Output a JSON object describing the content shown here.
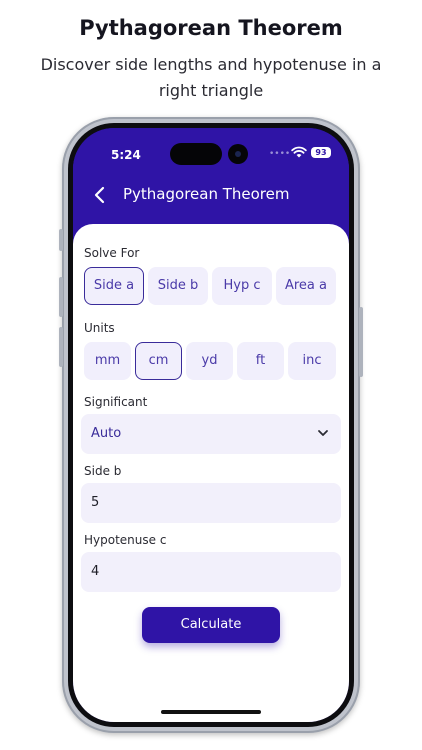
{
  "promo": {
    "title": "Pythagorean Theorem",
    "subtitle": "Discover side lengths and hypotenuse in a right triangle"
  },
  "status_bar": {
    "time": "5:24",
    "battery": "93"
  },
  "header": {
    "title": "Pythagorean Theorem",
    "back_icon": "chevron-left-icon"
  },
  "solve_for": {
    "label": "Solve For",
    "options": [
      "Side a",
      "Side b",
      "Hyp c",
      "Area a"
    ],
    "selected": "Side a"
  },
  "units": {
    "label": "Units",
    "options": [
      "mm",
      "cm",
      "yd",
      "ft",
      "inc"
    ],
    "selected": "cm"
  },
  "significant": {
    "label": "Significant",
    "value": "Auto",
    "icon": "chevron-down-icon"
  },
  "side_b": {
    "label": "Side b",
    "value": "5"
  },
  "hypotenuse_c": {
    "label": "Hypotenuse c",
    "value": "4"
  },
  "calculate": {
    "label": "Calculate"
  },
  "colors": {
    "primary": "#2f14a6",
    "chip_bg": "#f1effc",
    "field_bg": "#f2f0fb"
  }
}
